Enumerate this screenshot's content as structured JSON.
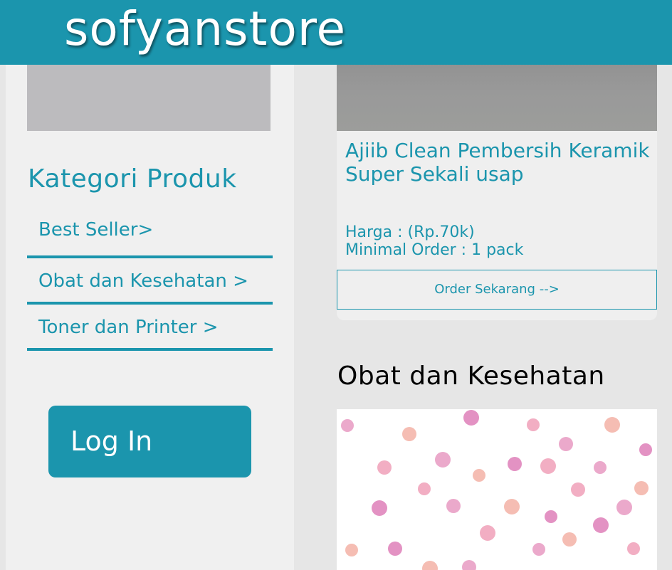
{
  "header": {
    "logo": "sofyanstore"
  },
  "sidebar": {
    "category_title": "Kategori Produk",
    "categories": [
      {
        "label": "Best Seller>"
      },
      {
        "label": "Obat dan Kesehatan >"
      },
      {
        "label": "Toner dan Printer >"
      }
    ],
    "login_label": "Log In"
  },
  "product": {
    "title": "Ajiib Clean Pembersih Keramik Super Sekali usap",
    "price": "Harga : (Rp.70k)",
    "min_order": "Minimal Order : 1 pack",
    "order_button": "Order Sekarang -->"
  },
  "section": {
    "title": "Obat dan Kesehatan"
  },
  "colors": {
    "accent": "#1b95ad",
    "page_background": "#e6e6e6",
    "sidebar_background": "#f0f0f0",
    "dots": [
      "#e89ac2",
      "#f3b2a6",
      "#de7fb8",
      "#f0a0b8"
    ]
  }
}
